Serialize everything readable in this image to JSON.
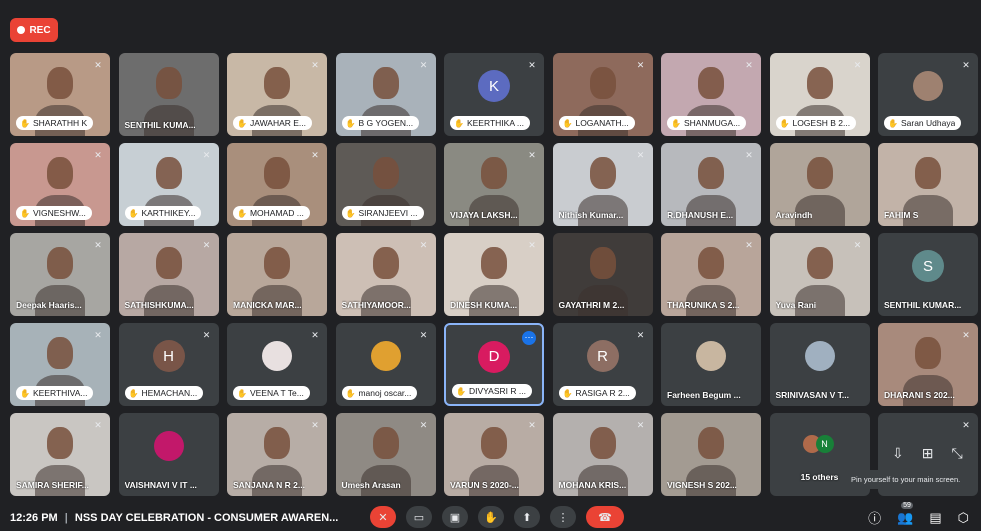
{
  "recording": {
    "label": "REC"
  },
  "tiles": [
    {
      "name": "SHARATHH K",
      "style": "pill",
      "kind": "video",
      "bg": "#b89a86"
    },
    {
      "name": "SENTHIL KUMA...",
      "style": "plain",
      "kind": "video",
      "bg": "#6d6d6d",
      "mic_state": "none"
    },
    {
      "name": "JAWAHAR E...",
      "style": "pill",
      "kind": "video",
      "bg": "#c8b8a6"
    },
    {
      "name": "B G YOGEN...",
      "style": "pill",
      "kind": "video",
      "bg": "#a9b2ba"
    },
    {
      "name": "KEERTHIKA ...",
      "style": "pill",
      "kind": "avatar",
      "initial": "K",
      "avatar_color": "#5c6bc0",
      "bg": "#3c4043"
    },
    {
      "name": "LOGANATH...",
      "style": "pill",
      "kind": "video",
      "bg": "#8e6a5c"
    },
    {
      "name": "SHANMUGA...",
      "style": "pill",
      "kind": "video",
      "bg": "#c3a8b0"
    },
    {
      "name": "LOGESH B 2...",
      "style": "pill",
      "kind": "video",
      "bg": "#d9d4cc"
    },
    {
      "name": "Saran Udhaya",
      "style": "pill",
      "kind": "photo",
      "bg": "#3c4043",
      "avatar_color": "#9e8170"
    },
    {
      "name": "VIGNESHW...",
      "style": "pill",
      "kind": "video",
      "bg": "#c89890"
    },
    {
      "name": "KARTHIKEY...",
      "style": "pill",
      "kind": "video",
      "bg": "#c7cfd4"
    },
    {
      "name": "MOHAMAD ...",
      "style": "pill",
      "kind": "video",
      "bg": "#a98f7c"
    },
    {
      "name": "SIRANJEEVI ...",
      "style": "pill",
      "kind": "video",
      "bg": "#5e5a56",
      "mic_state": "none"
    },
    {
      "name": "VIJAYA LAKSH...",
      "style": "plain",
      "kind": "video",
      "bg": "#8a8a82"
    },
    {
      "name": "Nithish Kumar...",
      "style": "plain",
      "kind": "video",
      "bg": "#c9ccd0"
    },
    {
      "name": "R.DHANUSH E...",
      "style": "plain",
      "kind": "video",
      "bg": "#b7b9bd"
    },
    {
      "name": "Aravindh",
      "style": "plain",
      "kind": "video",
      "bg": "#b0a59a",
      "mic_state": "none"
    },
    {
      "name": "FAHIM S",
      "style": "plain",
      "kind": "video",
      "bg": "#c2b3a8",
      "mic_state": "none"
    },
    {
      "name": "Deepak Haaris...",
      "style": "plain",
      "kind": "video",
      "bg": "#a7a6a2"
    },
    {
      "name": "SATHISHKUMA...",
      "style": "plain",
      "kind": "video",
      "bg": "#b7a8a3"
    },
    {
      "name": "MANICKA MAR...",
      "style": "plain",
      "kind": "video",
      "bg": "#b8a79a",
      "mic_state": "none"
    },
    {
      "name": "SATHIYAMOOR...",
      "style": "plain",
      "kind": "video",
      "bg": "#cdbfb5"
    },
    {
      "name": "DINESH KUMA...",
      "style": "plain",
      "kind": "video",
      "bg": "#d8cfc6"
    },
    {
      "name": "GAYATHRI M 2...",
      "style": "plain",
      "kind": "video",
      "bg": "#403c3a",
      "mic_state": "none"
    },
    {
      "name": "THARUNIKA S 2...",
      "style": "plain",
      "kind": "video",
      "bg": "#b8a59a"
    },
    {
      "name": "Yuva Rani",
      "style": "plain",
      "kind": "video",
      "bg": "#c7c1ba"
    },
    {
      "name": "SENTHIL KUMAR...",
      "style": "plain",
      "kind": "avatar",
      "initial": "S",
      "avatar_color": "#5f8a8b",
      "bg": "#3c4043",
      "mic_state": "none"
    },
    {
      "name": "KEERTHIVA...",
      "style": "pill",
      "kind": "video",
      "bg": "#a7b2b8"
    },
    {
      "name": "HEMACHAN...",
      "style": "pill",
      "kind": "avatar",
      "initial": "H",
      "avatar_color": "#795548",
      "bg": "#3c4043"
    },
    {
      "name": "VEENA T Te...",
      "style": "pill",
      "kind": "photo",
      "bg": "#3c4043",
      "avatar_color": "#e8e0e0"
    },
    {
      "name": "manoj oscar...",
      "style": "pill",
      "kind": "photo",
      "bg": "#3c4043",
      "avatar_color": "#e0a030"
    },
    {
      "name": "DIVYASRI R ...",
      "style": "pill",
      "kind": "avatar",
      "initial": "D",
      "avatar_color": "#d81b60",
      "bg": "#3c4043",
      "active": true
    },
    {
      "name": "RASIGA R 2...",
      "style": "pill",
      "kind": "avatar",
      "initial": "R",
      "avatar_color": "#8d6e63",
      "bg": "#3c4043"
    },
    {
      "name": "Farheen Begum ...",
      "style": "plain",
      "kind": "photo",
      "bg": "#3c4043",
      "avatar_color": "#c8b6a0",
      "mic_state": "none"
    },
    {
      "name": "SRINIVASAN V T...",
      "style": "plain",
      "kind": "photo",
      "bg": "#3c4043",
      "avatar_color": "#a0b0c0",
      "mic_state": "none"
    },
    {
      "name": "DHARANI S 202...",
      "style": "plain",
      "kind": "video",
      "bg": "#a88a7c"
    },
    {
      "name": "SAMIRA SHERIF...",
      "style": "plain",
      "kind": "video",
      "bg": "#c9c6c2"
    },
    {
      "name": "VAISHNAVI V IT ...",
      "style": "plain",
      "kind": "photo",
      "bg": "#3c4043",
      "avatar_color": "#c2186a",
      "mic_state": "none"
    },
    {
      "name": "SANJANA N R 2...",
      "style": "plain",
      "kind": "video",
      "bg": "#b7ada6"
    },
    {
      "name": "Umesh Arasan",
      "style": "plain",
      "kind": "video",
      "bg": "#8f8a84"
    },
    {
      "name": "VARUN S 2020-...",
      "style": "plain",
      "kind": "video",
      "bg": "#b8aca4"
    },
    {
      "name": "MOHANA KRIS...",
      "style": "plain",
      "kind": "video",
      "bg": "#b4b0ae"
    },
    {
      "name": "VIGNESH S 202...",
      "style": "plain",
      "kind": "video",
      "bg": "#a39b92",
      "mic_state": "none"
    }
  ],
  "others": {
    "label": "15 others",
    "initial": "N"
  },
  "pin_tooltip": "Pin yourself to your main screen.",
  "bottom_bar": {
    "time": "12:26 PM",
    "separator": "|",
    "meeting_title": "NSS DAY CELEBRATION - CONSUMER AWAREN...",
    "people_count": "59"
  },
  "colors": {
    "accent": "#8ab4f8",
    "end_call": "#ea4335",
    "background": "#202124"
  }
}
